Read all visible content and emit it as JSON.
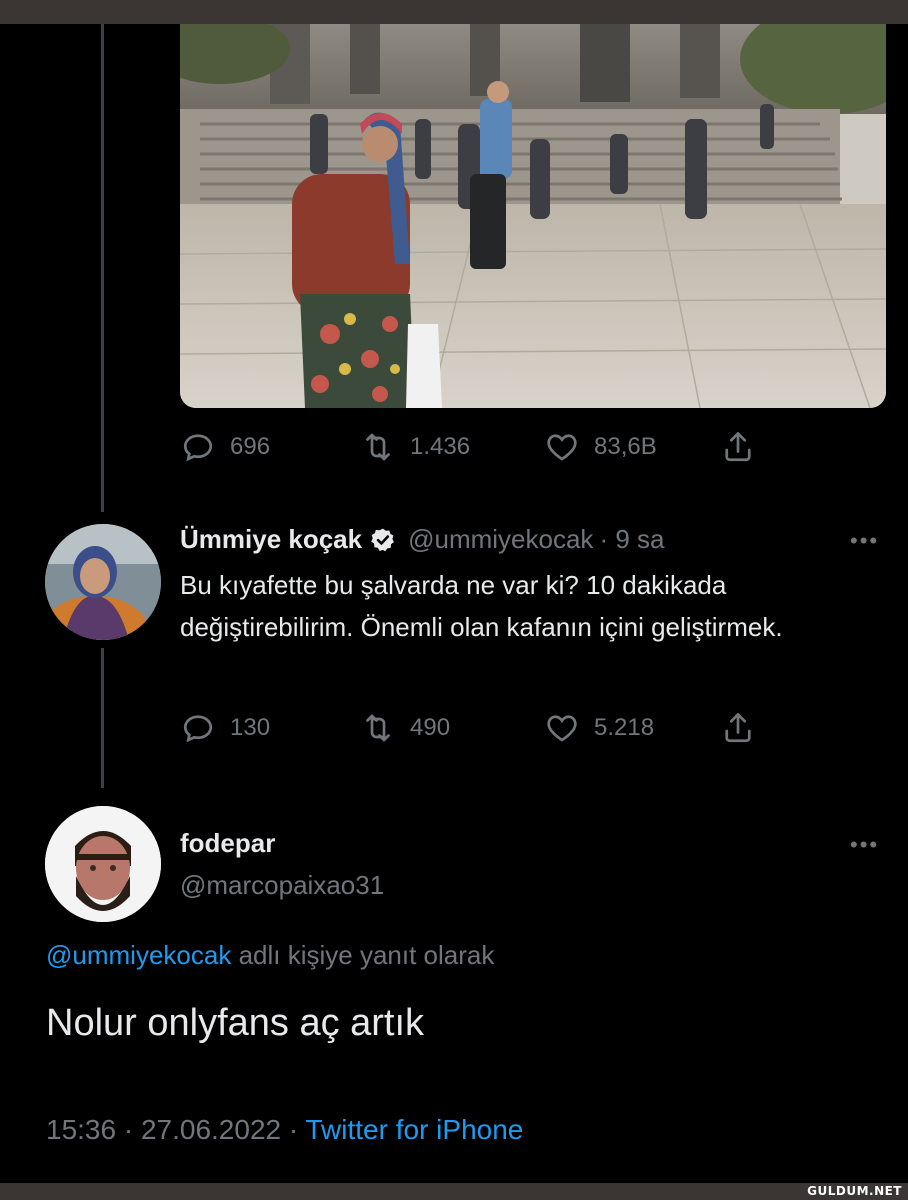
{
  "quoted_tweet": {
    "media": {
      "description_icon": "photo"
    },
    "actions": {
      "replies": "696",
      "retweets": "1.436",
      "likes": "83,6B"
    }
  },
  "reply_tweet": {
    "display_name": "Ümmiye koçak",
    "handle": "@ummiyekocak",
    "time": "· 9 sa",
    "text": "Bu kıyafette bu şalvarda ne var ki? 10 dakikada değiştirebilirim. Önemli olan kafanın içini geliştirmek.",
    "actions": {
      "replies": "130",
      "retweets": "490",
      "likes": "5.218"
    }
  },
  "main_tweet": {
    "display_name": "fodepar",
    "handle": "@marcopaixao31",
    "reply_to_mention": "@ummiyekocak",
    "reply_to_suffix": "adlı kişiye yanıt olarak",
    "text": "Nolur onlyfans aç artık",
    "timestamp": "15:36 · 27.06.2022 ·",
    "source": "Twitter for iPhone"
  },
  "watermark": "GULDUM.NET",
  "colors": {
    "background": "#000000",
    "text_primary": "#e7e9ea",
    "text_secondary": "#71767b",
    "accent_blue": "#1d9bf0"
  }
}
